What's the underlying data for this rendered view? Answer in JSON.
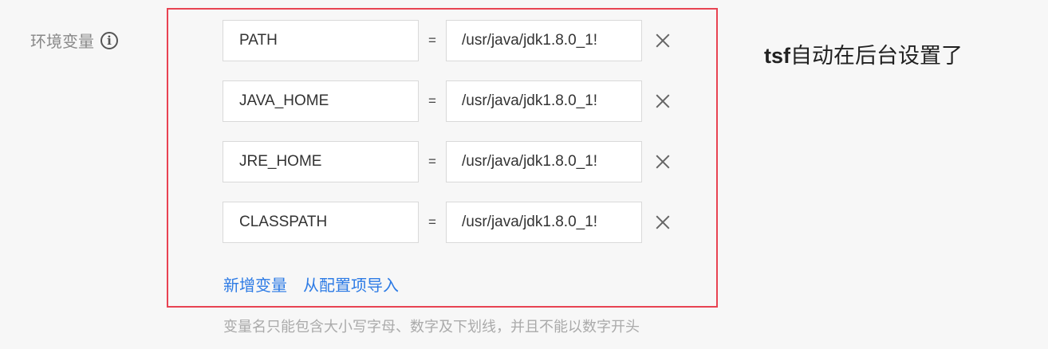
{
  "form": {
    "label": "环境变量",
    "info_icon": "info-circle-icon",
    "rows": [
      {
        "name": "PATH",
        "equals": "=",
        "value": "/usr/java/jdk1.8.0_1!"
      },
      {
        "name": "JAVA_HOME",
        "equals": "=",
        "value": "/usr/java/jdk1.8.0_1!"
      },
      {
        "name": "JRE_HOME",
        "equals": "=",
        "value": "/usr/java/jdk1.8.0_1!"
      },
      {
        "name": "CLASSPATH",
        "equals": "=",
        "value": "/usr/java/jdk1.8.0_1!"
      }
    ],
    "add_variable_link": "新增变量",
    "import_link": "从配置项导入",
    "hint": "变量名只能包含大小写字母、数字及下划线，并且不能以数字开头"
  },
  "annotation": {
    "bold_prefix": "tsf",
    "text": "自动在后台设置了",
    "box_color": "#e84352"
  },
  "colors": {
    "link": "#2d7be5"
  }
}
